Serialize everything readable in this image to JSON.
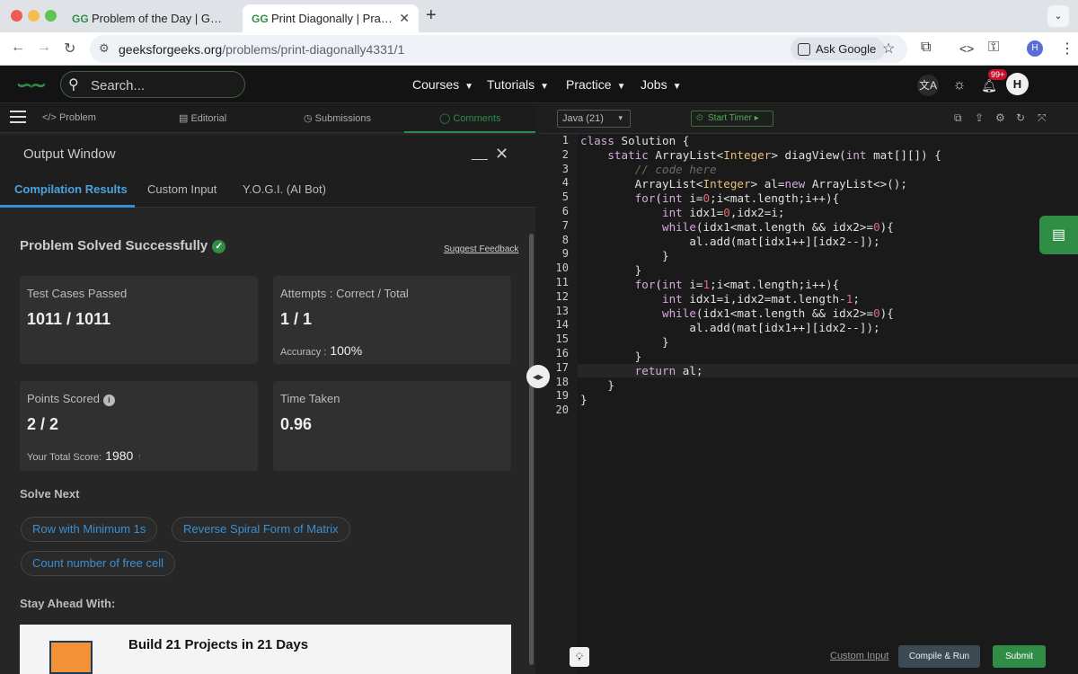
{
  "browser": {
    "tabs": [
      {
        "title": "Problem of the Day | Geeksfor"
      },
      {
        "title": "Print Diagonally | Practice | G"
      }
    ],
    "url_host": "geeksforgeeks.org",
    "url_path": "/problems/print-diagonally4331/1",
    "ask_google": "Ask Google",
    "profile_initial": "H"
  },
  "site": {
    "search_placeholder": "Search...",
    "menus": [
      "Courses",
      "Tutorials",
      "Practice",
      "Jobs"
    ],
    "notif_badge": "99+",
    "avatar": "H"
  },
  "left": {
    "tabs": [
      "Problem",
      "Editorial",
      "Submissions",
      "Comments"
    ],
    "output_title": "Output Window",
    "result_tabs": [
      "Compilation Results",
      "Custom Input",
      "Y.O.G.I. (AI Bot)"
    ],
    "status": "Problem Solved Successfully",
    "feedback": "Suggest Feedback",
    "cards": {
      "tests_label": "Test Cases Passed",
      "tests_value": "1011 / 1011",
      "attempts_label": "Attempts : Correct / Total",
      "attempts_value": "1 / 1",
      "accuracy_label": "Accuracy :",
      "accuracy_value": "100%",
      "points_label": "Points Scored",
      "points_value": "2 / 2",
      "total_label": "Your Total Score:",
      "total_value": "1980",
      "time_label": "Time Taken",
      "time_value": "0.96"
    },
    "solve_next": "Solve Next",
    "chips": [
      "Row with Minimum 1s",
      "Reverse Spiral Form of Matrix",
      "Count number of free cell"
    ],
    "stay_ahead": "Stay Ahead With:",
    "banner_title": "Build 21 Projects in 21 Days"
  },
  "editor": {
    "language": "Java (21)",
    "timer": "Start Timer",
    "line_count": 20,
    "custom_input": "Custom Input",
    "compile_run": "Compile & Run",
    "submit": "Submit"
  }
}
